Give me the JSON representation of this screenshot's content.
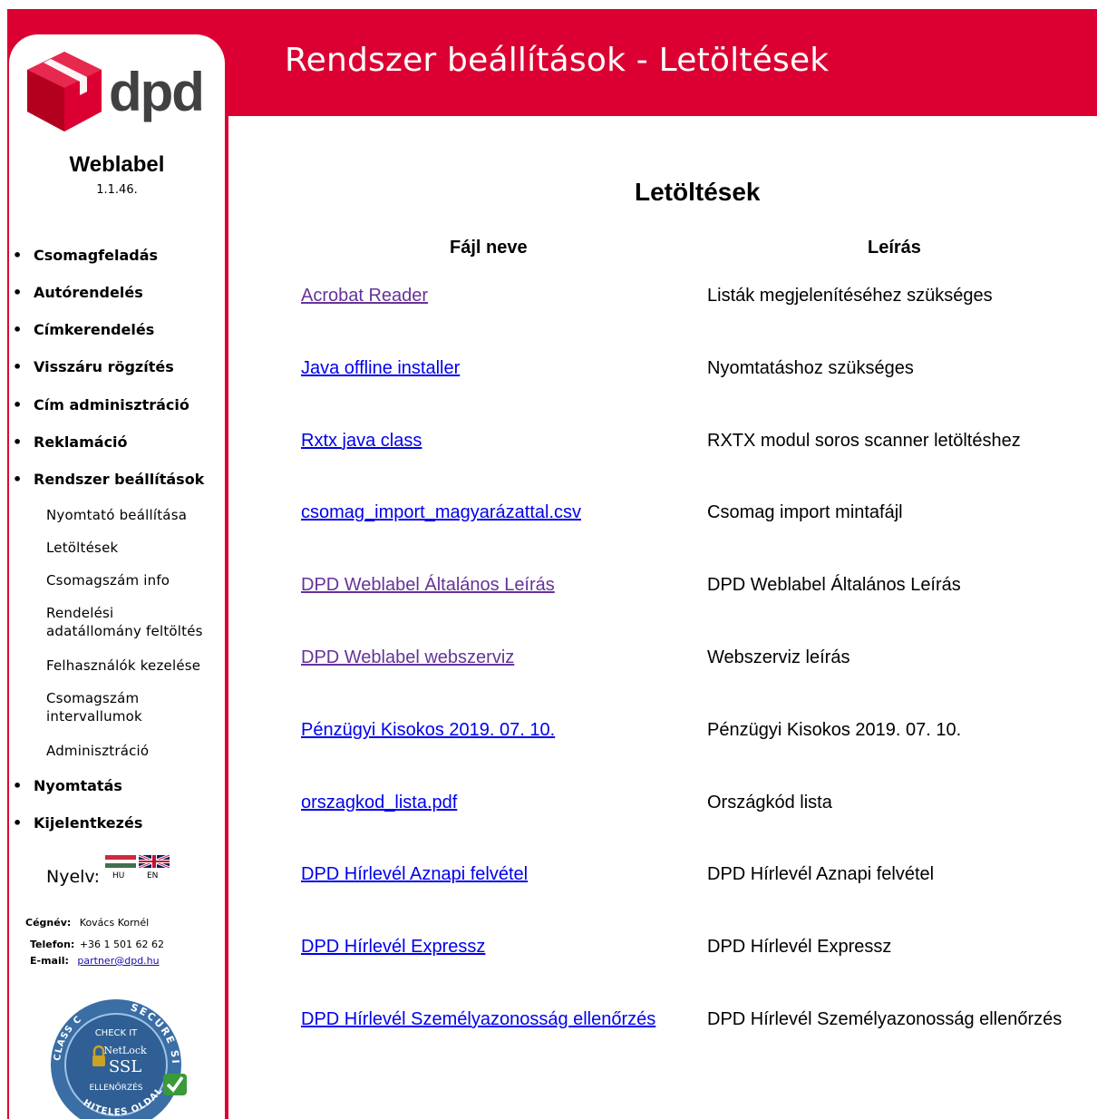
{
  "brand": {
    "logo_text": "dpd",
    "red": "#dc0032",
    "grey": "#414042"
  },
  "header": {
    "title": "Rendszer beállítások - Letöltések"
  },
  "sidebar": {
    "app_name": "Weblabel",
    "version": "1.1.46.",
    "menu": [
      {
        "label": "Csomagfeladás"
      },
      {
        "label": "Autórendelés"
      },
      {
        "label": "Címkerendelés"
      },
      {
        "label": "Visszáru rögzítés"
      },
      {
        "label": "Cím adminisztráció"
      },
      {
        "label": "Reklamáció"
      },
      {
        "label": "Rendszer beállítások"
      }
    ],
    "submenu": [
      {
        "label": "Nyomtató beállítása"
      },
      {
        "label": "Letöltések"
      },
      {
        "label": "Csomagszám info"
      },
      {
        "label": "Rendelési adatállomány feltöltés"
      },
      {
        "label": "Felhasználók kezelése"
      },
      {
        "label": "Csomagszám intervallumok"
      },
      {
        "label": "Adminisztráció"
      }
    ],
    "menu_after": [
      {
        "label": "Nyomtatás"
      },
      {
        "label": "Kijelentkezés"
      }
    ],
    "language": {
      "label": "Nyelv:",
      "hu": "HU",
      "en": "EN"
    },
    "company": {
      "name_label": "Cégnév:",
      "name_value": "Kovács Kornél",
      "phone_label": "Telefon:",
      "phone_value": "+36 1 501 62 62",
      "email_label": "E-mail:",
      "email_value": "partner@dpd.hu"
    },
    "seal": {
      "check_it": "CHECK IT",
      "brand": "NetLock",
      "ssl": "SSL",
      "verify": "ELLENŐRZÉS",
      "secure_site": "SECURE SITE",
      "class_c": "CLASS C",
      "hiteles_oldal": "HITELES OLDAL"
    }
  },
  "downloads": {
    "title": "Letöltések",
    "col_file": "Fájl neve",
    "col_desc": "Leírás",
    "rows": [
      {
        "file": "Acrobat Reader",
        "desc": "Listák megjelenítéséhez szükséges",
        "visited": true
      },
      {
        "file": "Java offline installer",
        "desc": "Nyomtatáshoz szükséges",
        "visited": false
      },
      {
        "file": "Rxtx java class",
        "desc": "RXTX modul soros scanner letöltéshez",
        "visited": false
      },
      {
        "file": "csomag_import_magyarázattal.csv",
        "desc": "Csomag import mintafájl",
        "visited": false
      },
      {
        "file": "DPD Weblabel Általános Leírás",
        "desc": "DPD Weblabel Általános Leírás",
        "visited": true
      },
      {
        "file": "DPD Weblabel webszerviz",
        "desc": "Webszerviz leírás",
        "visited": true
      },
      {
        "file": "Pénzügyi Kisokos 2019. 07. 10.",
        "desc": "Pénzügyi Kisokos 2019. 07. 10.",
        "visited": false
      },
      {
        "file": "orszagkod_lista.pdf",
        "desc": "Országkód lista",
        "visited": false
      },
      {
        "file": "DPD Hírlevél Aznapi felvétel",
        "desc": "DPD Hírlevél Aznapi felvétel",
        "visited": false
      },
      {
        "file": "DPD Hírlevél Expressz",
        "desc": "DPD Hírlevél Expressz",
        "visited": false
      },
      {
        "file": "DPD Hírlevél Személyazonosság ellenőrzés",
        "desc": "DPD Hírlevél Személyazonosság ellenőrzés",
        "visited": false
      }
    ]
  }
}
